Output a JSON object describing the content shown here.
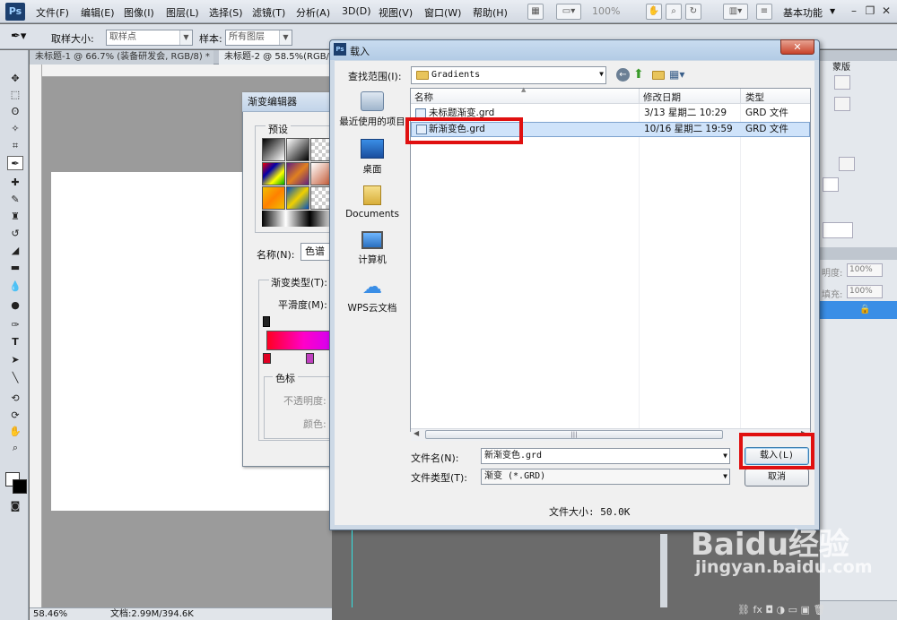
{
  "app": {
    "logo": "Ps",
    "menu": [
      "文件(F)",
      "编辑(E)",
      "图像(I)",
      "图层(L)",
      "选择(S)",
      "滤镜(T)",
      "分析(A)",
      "3D(D)",
      "视图(V)",
      "窗口(W)",
      "帮助(H)"
    ],
    "zoom": "100%",
    "workspace": "基本功能"
  },
  "options_bar": {
    "sample_size_label": "取样大小:",
    "sample_size_value": "取样点",
    "sample_label": "样本:",
    "sample_value": "所有图层"
  },
  "doc_tabs": [
    "未标题-1 @ 66.7% (装备研发会, RGB/8) *",
    "未标题-2 @ 58.5%(RGB/8)"
  ],
  "status_bar": {
    "zoom": "58.46%",
    "doc_size": "文档:2.99M/394.6K"
  },
  "gradient_editor": {
    "title": "渐变编辑器",
    "presets_label": "预设",
    "name_label": "名称(N):",
    "name_value": "色谱",
    "gradient_type_label": "渐变类型(T):",
    "smoothness_label": "平滑度(M):",
    "color_stops_label": "色标",
    "opacity_label": "不透明度:",
    "color_label": "颜色:"
  },
  "load_dialog": {
    "title": "载入",
    "look_in_label": "查找范围(I):",
    "look_in_value": "Gradients",
    "places": [
      "最近使用的项目",
      "桌面",
      "Documents",
      "计算机",
      "WPS云文档"
    ],
    "columns": [
      "名称",
      "修改日期",
      "类型"
    ],
    "files": [
      {
        "name": "未标题渐变.grd",
        "date": "3/13 星期二 10:29",
        "type": "GRD 文件"
      },
      {
        "name": "新渐变色.grd",
        "date": "10/16 星期二 19:59",
        "type": "GRD 文件"
      }
    ],
    "file_name_label": "文件名(N):",
    "file_name_value": "新渐变色.grd",
    "file_type_label": "文件类型(T):",
    "file_type_value": "渐变 (*.GRD)",
    "load_button": "载入(L)",
    "cancel_button": "取消",
    "file_size": "文件大小: 50.0K"
  },
  "right_panel": {
    "tab": "蒙版",
    "opacity_label": "明度:",
    "opacity_value": "100%",
    "fill_label": "填充:",
    "fill_value": "100%"
  },
  "watermark": {
    "brand": "Baidu经验",
    "url": "jingyan.baidu.com"
  },
  "colors": {
    "highlight": "#e01010",
    "selection": "#cfe3fa",
    "ps_blue": "#1c3f6e"
  }
}
